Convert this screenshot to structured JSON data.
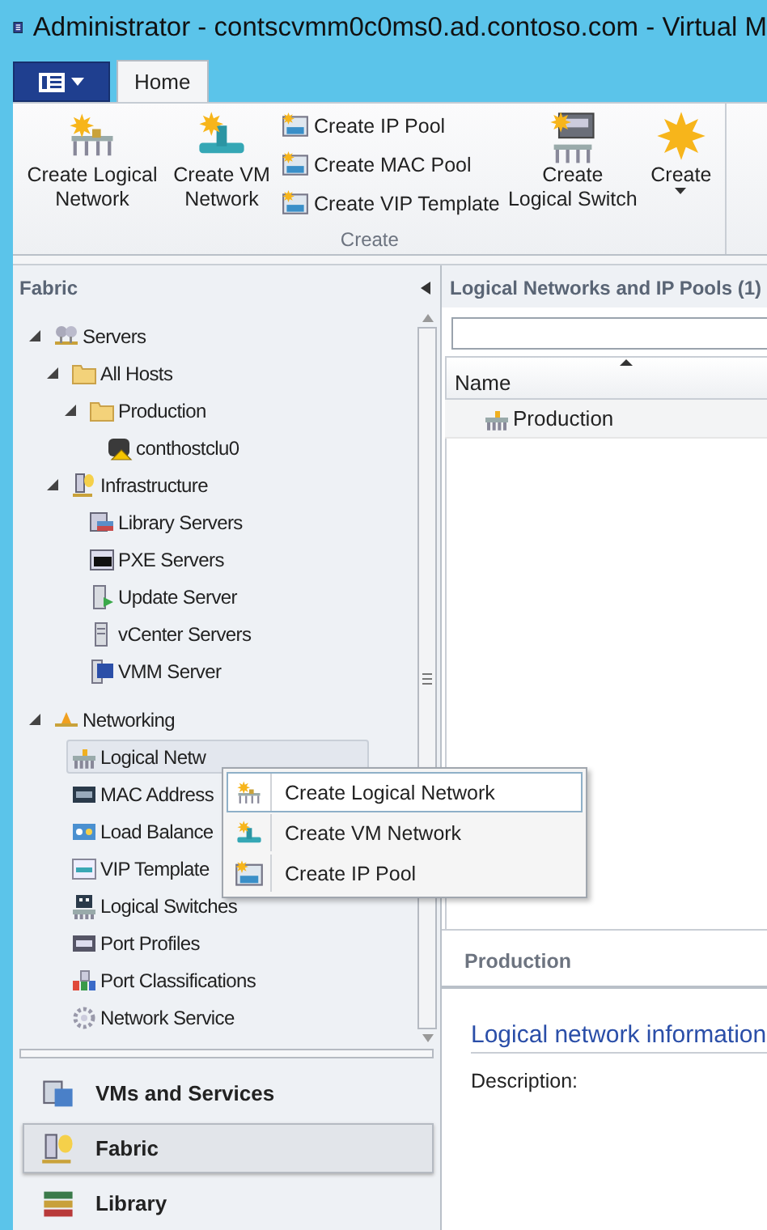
{
  "window": {
    "title": "Administrator - contscvmm0c0ms0.ad.contoso.com - Virtual M"
  },
  "ribbon": {
    "tabs": [
      {
        "label": "Home",
        "selected": true
      }
    ],
    "groups": [
      {
        "label": "Create",
        "buttons": [
          {
            "kind": "large",
            "label": "Create Logical Network"
          },
          {
            "kind": "large",
            "label": "Create VM Network"
          },
          {
            "kind": "small",
            "label": "Create IP Pool"
          },
          {
            "kind": "small",
            "label": "Create MAC Pool"
          },
          {
            "kind": "small",
            "label": "Create VIP Template"
          },
          {
            "kind": "large",
            "label": "Create Logical Switch"
          },
          {
            "kind": "dropdown",
            "label": "Create"
          }
        ]
      }
    ]
  },
  "navigation": {
    "title": "Fabric",
    "tree": [
      {
        "label": "Servers",
        "selected": false,
        "expanded": true,
        "children": [
          {
            "label": "All Hosts",
            "selected": false,
            "expanded": true,
            "children": [
              {
                "label": "Production",
                "selected": false,
                "expanded": true,
                "children": [
                  {
                    "label": "conthostclu0",
                    "selected": false
                  }
                ]
              }
            ]
          },
          {
            "label": "Infrastructure",
            "selected": false,
            "expanded": true,
            "children": [
              {
                "label": "Library Servers",
                "selected": false
              },
              {
                "label": "PXE Servers",
                "selected": false
              },
              {
                "label": "Update Server",
                "selected": false
              },
              {
                "label": "vCenter Servers",
                "selected": false
              },
              {
                "label": "VMM Server",
                "selected": false
              }
            ]
          }
        ]
      },
      {
        "label": "Networking",
        "selected": false,
        "expanded": true,
        "children": [
          {
            "label": "Logical Netw",
            "selected": true
          },
          {
            "label": "MAC Address",
            "selected": false
          },
          {
            "label": "Load Balance",
            "selected": false
          },
          {
            "label": "VIP Template",
            "selected": false
          },
          {
            "label": "Logical Switches",
            "selected": false
          },
          {
            "label": "Port Profiles",
            "selected": false
          },
          {
            "label": "Port Classifications",
            "selected": false
          },
          {
            "label": "Network Service",
            "selected": false
          }
        ]
      }
    ],
    "workspaces": [
      {
        "label": "VMs and Services",
        "selected": false
      },
      {
        "label": "Fabric",
        "selected": true
      },
      {
        "label": "Library",
        "selected": false
      }
    ]
  },
  "content": {
    "title": "Logical Networks and IP Pools (1)",
    "table": {
      "columns": [
        {
          "label": "Name",
          "sorted": true
        }
      ],
      "rows": [
        {
          "name": "Production",
          "selected": true
        }
      ]
    },
    "details": {
      "title": "Production",
      "section": "Logical network information",
      "fields": [
        {
          "label": "Description:"
        }
      ]
    }
  },
  "context_menu": {
    "items": [
      {
        "label": "Create Logical Network",
        "selected": true
      },
      {
        "label": "Create VM Network",
        "selected": false
      },
      {
        "label": "Create IP Pool",
        "selected": false
      }
    ]
  }
}
